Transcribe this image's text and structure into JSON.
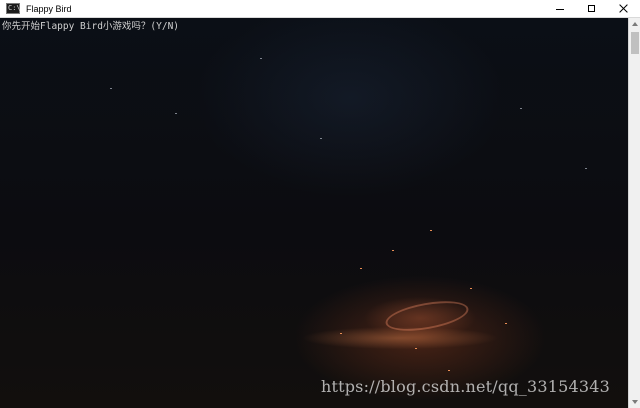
{
  "window": {
    "title": "Flappy Bird",
    "icon": "console-icon",
    "controls": [
      "minimize",
      "maximize",
      "close"
    ]
  },
  "console": {
    "prompt_line": "你先开始Flappy Bird小游戏吗？(Y/N)"
  },
  "watermark": {
    "text": "https://blog.csdn.net/qq_33154343"
  }
}
